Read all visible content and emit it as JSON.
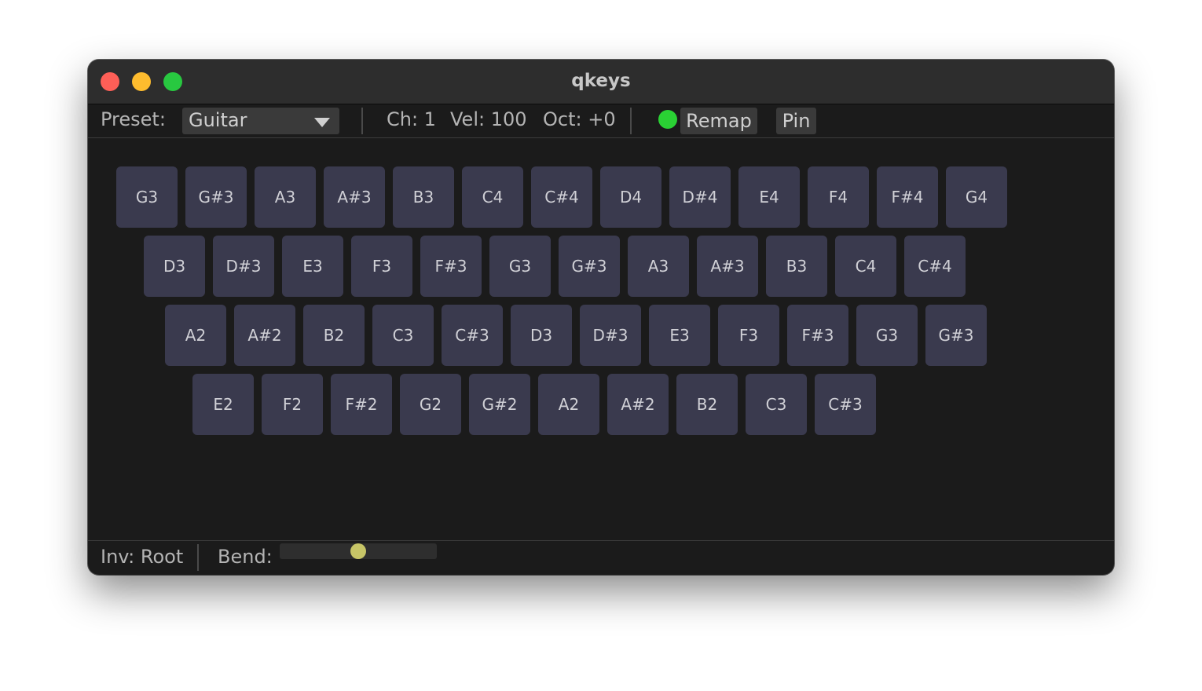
{
  "window": {
    "title": "qkeys"
  },
  "toolbar": {
    "preset_label": "Preset:",
    "preset_value": "Guitar",
    "channel": "Ch: 1",
    "velocity": "Vel: 100",
    "octave": "Oct: +0",
    "remap_label": "Remap",
    "pin_label": "Pin",
    "status_led_color": "#2ad134"
  },
  "keyboard": {
    "rows": [
      [
        "G3",
        "G#3",
        "A3",
        "A#3",
        "B3",
        "C4",
        "C#4",
        "D4",
        "D#4",
        "E4",
        "F4",
        "F#4",
        "G4"
      ],
      [
        "D3",
        "D#3",
        "E3",
        "F3",
        "F#3",
        "G3",
        "G#3",
        "A3",
        "A#3",
        "B3",
        "C4",
        "C#4"
      ],
      [
        "A2",
        "A#2",
        "B2",
        "C3",
        "C#3",
        "D3",
        "D#3",
        "E3",
        "F3",
        "F#3",
        "G3",
        "G#3"
      ],
      [
        "E2",
        "F2",
        "F#2",
        "G2",
        "G#2",
        "A2",
        "A#2",
        "B2",
        "C3",
        "C#3"
      ]
    ],
    "key_color": "#3a3a4e"
  },
  "statusbar": {
    "inversion": "Inv: Root",
    "bend_label": "Bend:",
    "bend_value": 0.5
  }
}
